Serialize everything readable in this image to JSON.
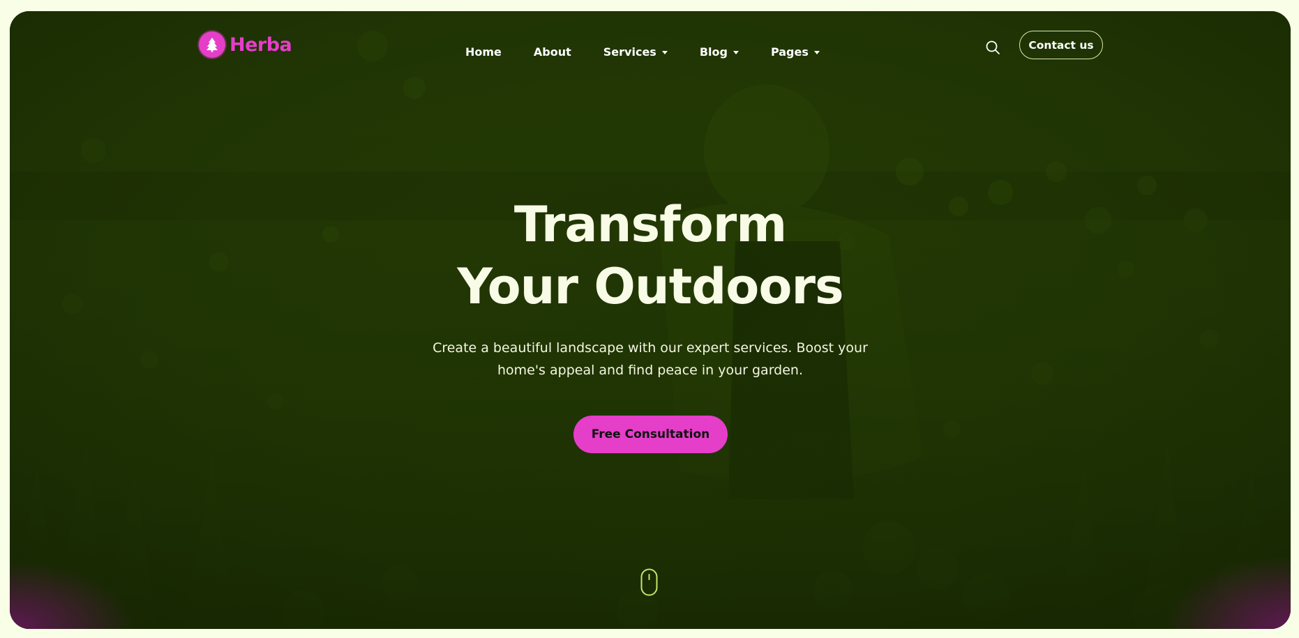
{
  "brand": {
    "name": "Herba",
    "logo_icon": "tree-icon",
    "accent_color": "#e53ec9"
  },
  "nav": {
    "items": [
      {
        "label": "Home",
        "has_dropdown": false
      },
      {
        "label": "About",
        "has_dropdown": false
      },
      {
        "label": "Services",
        "has_dropdown": true
      },
      {
        "label": "Blog",
        "has_dropdown": true
      },
      {
        "label": "Pages",
        "has_dropdown": true
      }
    ],
    "search_icon": "search-icon",
    "contact_label": "Contact us"
  },
  "hero": {
    "headline_line1": "Transform",
    "headline_line2": "Your Outdoors",
    "subtext": "Create a beautiful landscape with our expert services. Boost your home's appeal and find peace in your garden.",
    "cta_label": "Free Consultation",
    "scroll_icon": "mouse-scroll-icon",
    "overlay_color": "#1f3303"
  }
}
